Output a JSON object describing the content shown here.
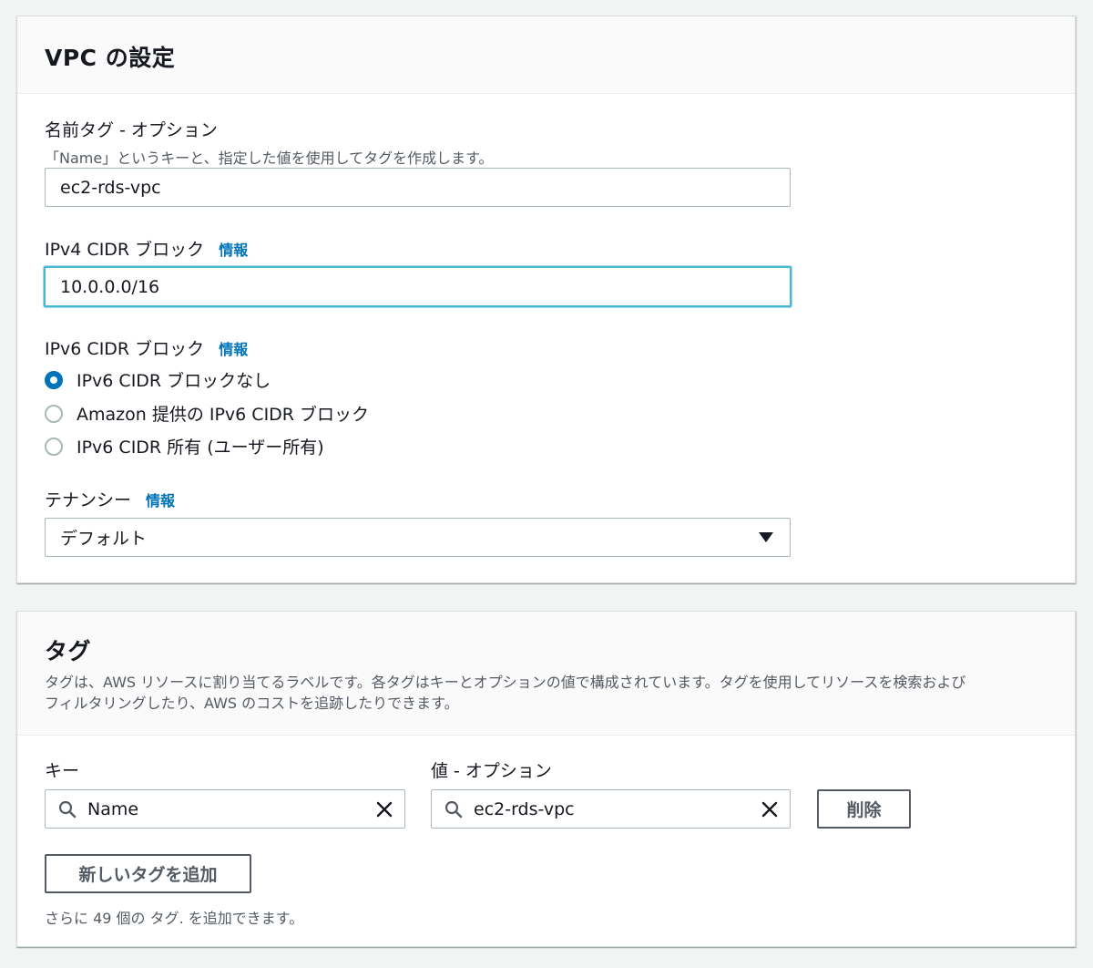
{
  "vpc_settings": {
    "title": "VPC の設定",
    "name_tag": {
      "label": "名前タグ - オプション",
      "hint": "「Name」というキーと、指定した値を使用してタグを作成します。",
      "value": "ec2-rds-vpc"
    },
    "ipv4": {
      "label": "IPv4 CIDR ブロック",
      "info": "情報",
      "value": "10.0.0.0/16"
    },
    "ipv6": {
      "label": "IPv6 CIDR ブロック",
      "info": "情報",
      "options": [
        {
          "label": "IPv6 CIDR ブロックなし",
          "selected": true
        },
        {
          "label": "Amazon 提供の IPv6 CIDR ブロック",
          "selected": false
        },
        {
          "label": "IPv6 CIDR 所有 (ユーザー所有)",
          "selected": false
        }
      ]
    },
    "tenancy": {
      "label": "テナンシー",
      "info": "情報",
      "value": "デフォルト"
    }
  },
  "tags": {
    "title": "タグ",
    "description_line1": "タグは、AWS リソースに割り当てるラベルです。各タグはキーとオプションの値で構成されています。タグを使用してリソースを検索および",
    "description_line2": "フィルタリングしたり、AWS のコストを追跡したりできます。",
    "key_label": "キー",
    "value_label": "値 - オプション",
    "rows": [
      {
        "key": "Name",
        "value": "ec2-rds-vpc"
      }
    ],
    "remove_label": "削除",
    "add_label": "新しいタグを追加",
    "remaining_hint": "さらに 49 個の タグ. を追加できます。"
  },
  "colors": {
    "accent": "#0073bb",
    "focus": "#44b9d6",
    "background": "#f2f3f3"
  },
  "icons": [
    "search-icon",
    "close-icon",
    "caret-down-icon"
  ]
}
